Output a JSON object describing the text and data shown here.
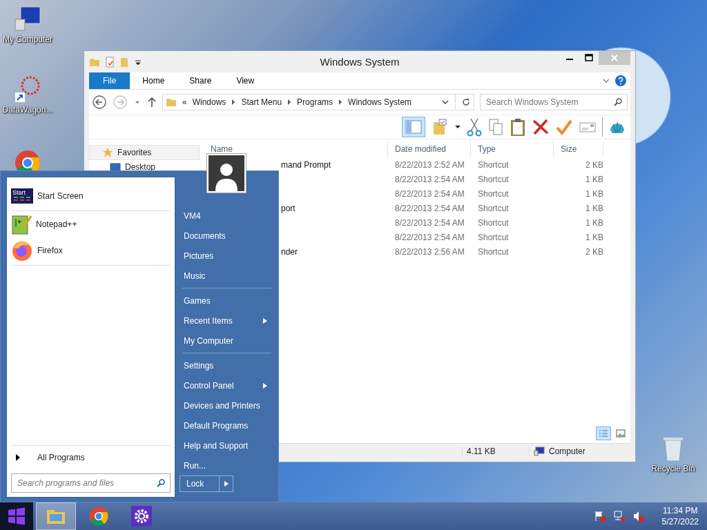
{
  "desktop": {
    "icons": [
      {
        "kind": "computer",
        "label": "My Computer"
      },
      {
        "kind": "shortcut",
        "label": "DataWagon..."
      },
      {
        "kind": "chrome"
      },
      {
        "kind": "recycle",
        "label": "Recycle Bin"
      }
    ]
  },
  "explorer": {
    "title": "Windows System",
    "ribbon_tabs": [
      {
        "label": "File",
        "kind": "menu"
      },
      {
        "label": "Home",
        "kind": "tab"
      },
      {
        "label": "Share",
        "kind": "tab"
      },
      {
        "label": "View",
        "kind": "tab"
      }
    ],
    "address": {
      "overflow": "«",
      "crumbs": [
        "Windows",
        "Start Menu",
        "Programs",
        "Windows System"
      ]
    },
    "search": {
      "placeholder": "Search Windows System"
    },
    "nav": [
      {
        "label": "Favorites",
        "kind": "group",
        "selected": true
      },
      {
        "label": "Desktop",
        "kind": "item",
        "selected": false
      }
    ],
    "columns": [
      "Name",
      "Date modified",
      "Type",
      "Size"
    ],
    "files": [
      {
        "name": "mand Prompt",
        "date": "8/22/2013 2:52 AM",
        "type": "Shortcut",
        "size": "2 KB"
      },
      {
        "date": "8/22/2013 2:54 AM",
        "type": "Shortcut",
        "size": "1 KB"
      },
      {
        "date": "8/22/2013 2:54 AM",
        "type": "Shortcut",
        "size": "1 KB"
      },
      {
        "name": "port",
        "date": "8/22/2013 2:54 AM",
        "type": "Shortcut",
        "size": "1 KB"
      },
      {
        "date": "8/22/2013 2:54 AM",
        "type": "Shortcut",
        "size": "1 KB"
      },
      {
        "date": "8/22/2013 2:54 AM",
        "type": "Shortcut",
        "size": "1 KB"
      },
      {
        "name": "nder",
        "date": "8/22/2013 2:56 AM",
        "type": "Shortcut",
        "size": "2 KB"
      }
    ],
    "status": {
      "size": "4.11 KB",
      "location": "Computer"
    }
  },
  "start_menu": {
    "pinned": [
      {
        "label": "Start Screen",
        "kind": "start",
        "icon_text": "Start"
      },
      {
        "label": "Notepad++",
        "kind": "notepad"
      },
      {
        "label": "Firefox",
        "kind": "firefox"
      }
    ],
    "all_programs": "All Programs",
    "search": {
      "placeholder": "Search programs and files"
    },
    "groups": [
      {
        "items": [
          {
            "label": "VM4",
            "submenu": false
          },
          {
            "label": "Documents",
            "submenu": false
          },
          {
            "label": "Pictures",
            "submenu": false
          },
          {
            "label": "Music",
            "submenu": false
          }
        ]
      },
      {
        "items": [
          {
            "label": "Games",
            "submenu": false
          },
          {
            "label": "Recent Items",
            "submenu": true
          },
          {
            "label": "My Computer",
            "submenu": false
          }
        ]
      },
      {
        "items": [
          {
            "label": "Settings",
            "submenu": false
          },
          {
            "label": "Control Panel",
            "submenu": true
          },
          {
            "label": "Devices and Printers",
            "submenu": false
          },
          {
            "label": "Default Programs",
            "submenu": false
          },
          {
            "label": "Help and Support",
            "submenu": false
          },
          {
            "label": "Run...",
            "submenu": false
          }
        ]
      }
    ],
    "power": {
      "label": "Lock"
    }
  },
  "taskbar": {
    "apps": [
      {
        "kind": "explorer",
        "selected": true
      },
      {
        "kind": "chrome",
        "selected": false
      },
      {
        "kind": "settings",
        "selected": false
      }
    ],
    "tray": [
      {
        "kind": "flag"
      },
      {
        "kind": "network"
      },
      {
        "kind": "volume"
      }
    ],
    "clock": {
      "time": "11:34 PM",
      "date": "5/27/2022"
    }
  }
}
